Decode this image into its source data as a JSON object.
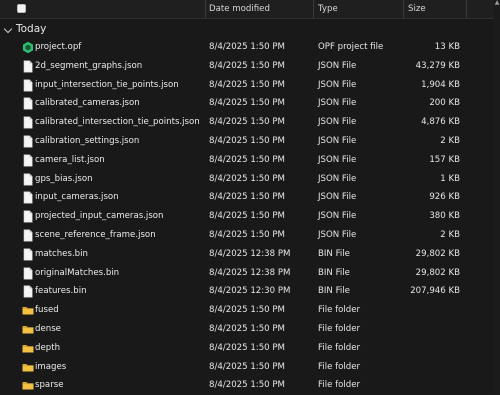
{
  "columns": {
    "date_modified": "Date modified",
    "type": "Type",
    "size": "Size"
  },
  "group": {
    "label": "Today"
  },
  "files": [
    {
      "name": "project.opf",
      "date": "8/4/2025 1:50 PM",
      "type": "OPF project file",
      "size": "13 KB",
      "icon": "opf-project-icon"
    },
    {
      "name": "2d_segment_graphs.json",
      "date": "8/4/2025 1:50 PM",
      "type": "JSON File",
      "size": "43,279 KB",
      "icon": "document-icon"
    },
    {
      "name": "input_intersection_tie_points.json",
      "date": "8/4/2025 1:50 PM",
      "type": "JSON File",
      "size": "1,904 KB",
      "icon": "document-icon"
    },
    {
      "name": "calibrated_cameras.json",
      "date": "8/4/2025 1:50 PM",
      "type": "JSON File",
      "size": "200 KB",
      "icon": "document-icon"
    },
    {
      "name": "calibrated_intersection_tie_points.json",
      "date": "8/4/2025 1:50 PM",
      "type": "JSON File",
      "size": "4,876 KB",
      "icon": "document-icon"
    },
    {
      "name": "calibration_settings.json",
      "date": "8/4/2025 1:50 PM",
      "type": "JSON File",
      "size": "2 KB",
      "icon": "document-icon"
    },
    {
      "name": "camera_list.json",
      "date": "8/4/2025 1:50 PM",
      "type": "JSON File",
      "size": "157 KB",
      "icon": "document-icon"
    },
    {
      "name": "gps_bias.json",
      "date": "8/4/2025 1:50 PM",
      "type": "JSON File",
      "size": "1 KB",
      "icon": "document-icon"
    },
    {
      "name": "input_cameras.json",
      "date": "8/4/2025 1:50 PM",
      "type": "JSON File",
      "size": "926 KB",
      "icon": "document-icon"
    },
    {
      "name": "projected_input_cameras.json",
      "date": "8/4/2025 1:50 PM",
      "type": "JSON File",
      "size": "380 KB",
      "icon": "document-icon"
    },
    {
      "name": "scene_reference_frame.json",
      "date": "8/4/2025 1:50 PM",
      "type": "JSON File",
      "size": "2 KB",
      "icon": "document-icon"
    },
    {
      "name": "matches.bin",
      "date": "8/4/2025 12:38 PM",
      "type": "BIN File",
      "size": "29,802 KB",
      "icon": "document-icon"
    },
    {
      "name": "originalMatches.bin",
      "date": "8/4/2025 12:38 PM",
      "type": "BIN File",
      "size": "29,802 KB",
      "icon": "document-icon"
    },
    {
      "name": "features.bin",
      "date": "8/4/2025 12:30 PM",
      "type": "BIN File",
      "size": "207,946 KB",
      "icon": "document-icon"
    },
    {
      "name": "fused",
      "date": "8/4/2025 1:50 PM",
      "type": "File folder",
      "size": "",
      "icon": "folder-icon"
    },
    {
      "name": "dense",
      "date": "8/4/2025 1:50 PM",
      "type": "File folder",
      "size": "",
      "icon": "folder-icon"
    },
    {
      "name": "depth",
      "date": "8/4/2025 1:50 PM",
      "type": "File folder",
      "size": "",
      "icon": "folder-icon"
    },
    {
      "name": "images",
      "date": "8/4/2025 1:50 PM",
      "type": "File folder",
      "size": "",
      "icon": "folder-icon"
    },
    {
      "name": "sparse",
      "date": "8/4/2025 1:50 PM",
      "type": "File folder",
      "size": "",
      "icon": "folder-icon"
    }
  ],
  "colors": {
    "background": "#191919",
    "folder": "#f2c043",
    "opf_icon": "#2fbf71"
  }
}
